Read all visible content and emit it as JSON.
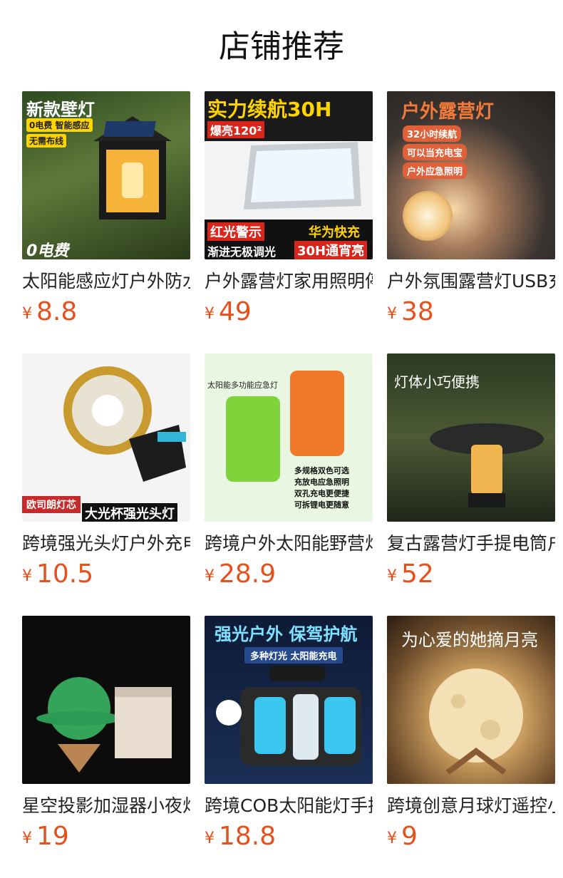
{
  "page_title": "店铺推荐",
  "currency_symbol": "¥",
  "products": [
    {
      "name": "太阳能感应灯户外防水庭院灯",
      "price": "8.8",
      "image_texts": [
        "新款壁灯",
        "0电费 智能感应",
        "无需布线",
        "0电费"
      ]
    },
    {
      "name": "户外露营灯家用照明停电应急灯",
      "price": "49",
      "image_texts": [
        "实力续航30H",
        "爆亮120²",
        "红光警示",
        "华为快充",
        "渐进无极调光",
        "30H通宵亮"
      ]
    },
    {
      "name": "户外氛围露营灯USB充电",
      "price": "38",
      "image_texts": [
        "户外露营灯",
        "32小时续航",
        "可以当充电宝",
        "户外应急照明"
      ]
    },
    {
      "name": "跨境强光头灯户外充电头戴式",
      "price": "10.5",
      "image_texts": [
        "欧司朗灯芯",
        "大光杯强光头灯"
      ]
    },
    {
      "name": "跨境户外太阳能野营灯多功能",
      "price": "28.9",
      "image_texts": [
        "太阳能多功能应急灯",
        "多规格双色可选",
        "充放电应急照明",
        "双孔充电更便捷",
        "可拆锂电更随意"
      ]
    },
    {
      "name": "复古露营灯手提电筒户外",
      "price": "52",
      "image_texts": [
        "灯体小巧便携"
      ]
    },
    {
      "name": "星空投影加湿器小夜灯",
      "price": "19",
      "image_texts": []
    },
    {
      "name": "跨境COB太阳能灯手提探照灯",
      "price": "18.8",
      "image_texts": [
        "强光户外 保驾护航",
        "多种灯光 太阳能充电"
      ]
    },
    {
      "name": "跨境创意月球灯遥控小夜灯",
      "price": "9",
      "image_texts": [
        "为心爱的她摘月亮"
      ]
    }
  ]
}
